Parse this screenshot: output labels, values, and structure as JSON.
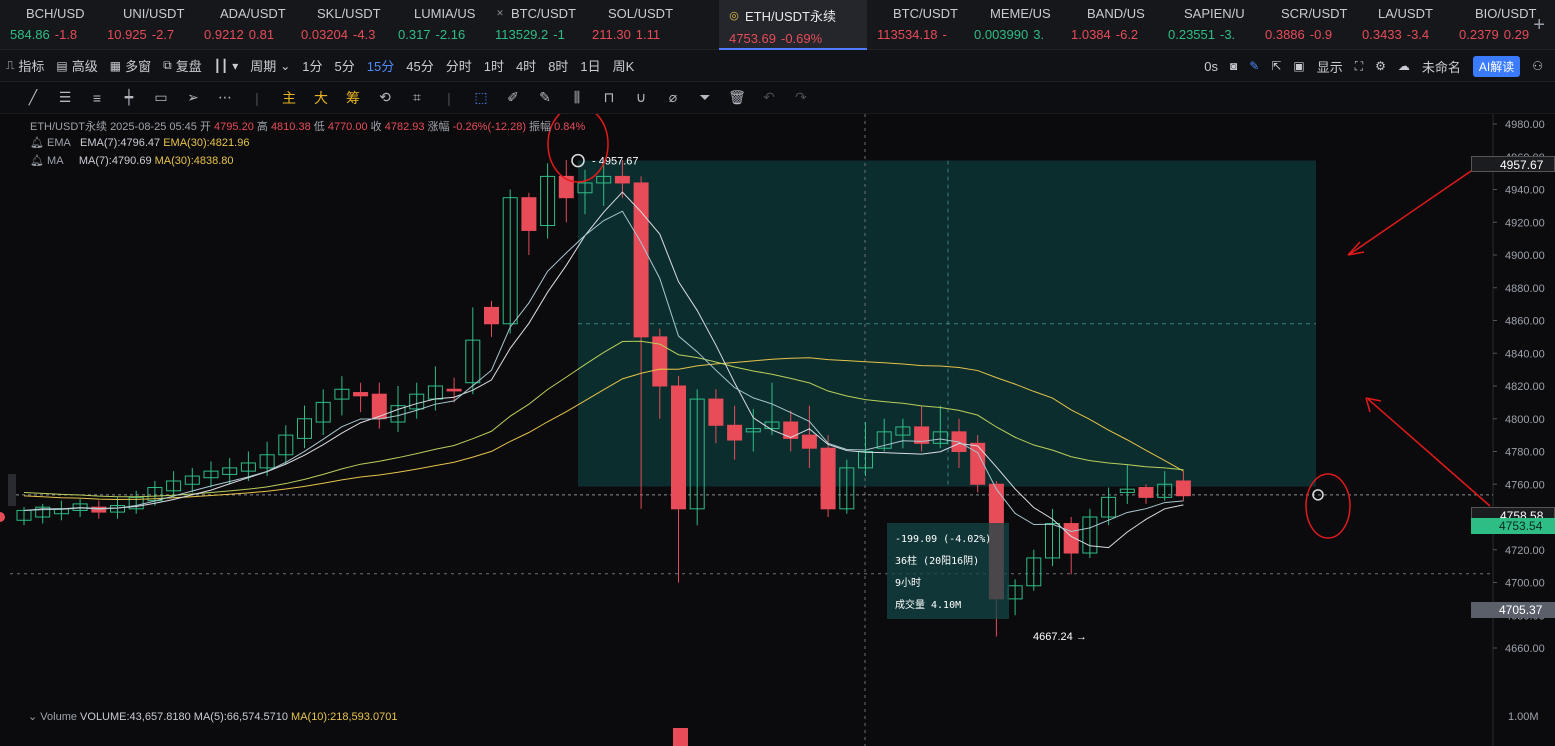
{
  "tickers": [
    {
      "name": "BCH/USD",
      "icon": "",
      "price": "584.86",
      "change": "-1.8",
      "price_dir": "up",
      "change_dir": "dn"
    },
    {
      "name": "UNI/USDT",
      "icon": "",
      "price": "10.925",
      "change": "-2.7",
      "price_dir": "dn",
      "change_dir": "dn"
    },
    {
      "name": "ADA/USDT",
      "icon": "",
      "price": "0.9212",
      "change": "0.81",
      "price_dir": "dn",
      "change_dir": "dn"
    },
    {
      "name": "SKL/USDT",
      "icon": "",
      "price": "0.03204",
      "change": "-4.3",
      "price_dir": "dn",
      "change_dir": "dn"
    },
    {
      "name": "LUMIA/US",
      "icon": "",
      "price": "0.317",
      "change": "-2.16",
      "price_dir": "up",
      "change_dir": "up"
    },
    {
      "name": "BTC/USDT",
      "icon": "✕",
      "price": "113529.2",
      "change": "-1",
      "price_dir": "up",
      "change_dir": "up"
    },
    {
      "name": "SOL/USDT",
      "icon": "",
      "price": "211.30",
      "change": "1.11",
      "price_dir": "dn",
      "change_dir": "dn"
    },
    {
      "name": "ETH/USDT永续",
      "icon": "◎",
      "price": "4753.69",
      "change": "-0.69%",
      "price_dir": "dn",
      "change_dir": "dn",
      "active": true
    },
    {
      "name": "BTC/USDT",
      "icon": "",
      "price": "113534.18",
      "change": "-",
      "price_dir": "dn",
      "change_dir": "dn"
    },
    {
      "name": "MEME/US",
      "icon": "",
      "price": "0.003990",
      "change": "3.",
      "price_dir": "up",
      "change_dir": "up"
    },
    {
      "name": "BAND/US",
      "icon": "",
      "price": "1.0384",
      "change": "-6.2",
      "price_dir": "dn",
      "change_dir": "dn"
    },
    {
      "name": "SAPIEN/U",
      "icon": "",
      "price": "0.23551",
      "change": "-3.",
      "price_dir": "up",
      "change_dir": "up"
    },
    {
      "name": "SCR/USDT",
      "icon": "",
      "price": "0.3886",
      "change": "-0.9",
      "price_dir": "dn",
      "change_dir": "dn"
    },
    {
      "name": "LA/USDT",
      "icon": "",
      "price": "0.3433",
      "change": "-3.4",
      "price_dir": "dn",
      "change_dir": "dn"
    },
    {
      "name": "BIO/USDT",
      "icon": "",
      "price": "0.2379",
      "change": "0.29",
      "price_dir": "dn",
      "change_dir": "dn"
    }
  ],
  "toolbar": {
    "indicators": "指标",
    "advanced": "高级",
    "multi_window": "多窗",
    "replay": "复盘",
    "period": "周期",
    "intervals": [
      "1分",
      "5分",
      "15分",
      "45分",
      "分时",
      "1时",
      "4时",
      "8时",
      "1日",
      "周K"
    ],
    "active_interval": "15分",
    "countdown": "0s",
    "display": "显示",
    "layout_name": "未命名",
    "ai_button": "AI解读"
  },
  "drawbar": {
    "main_label": "主",
    "big_label": "大",
    "chip_label": "筹"
  },
  "chart_info": {
    "symbol": "ETH/USDT永续",
    "datetime": "2025-08-25 05:45",
    "open_label": "开",
    "open": "4795.20",
    "high_label": "高",
    "high": "4810.38",
    "low_label": "低",
    "low": "4770.00",
    "close_label": "收",
    "close": "4782.93",
    "change_label": "涨幅",
    "change": "-0.26%(-12.28)",
    "amp_label": "振幅",
    "amp": "0.84%",
    "ema_label": "EMA",
    "ema7": "EMA(7):4796.47",
    "ema30": "EMA(30):4821.96",
    "ma_label": "MA",
    "ma7": "MA(7):4790.69",
    "ma30": "MA(30):4838.80",
    "volume_label": "Volume",
    "volume": "VOLUME:43,657.8180",
    "vol_ma5": "MA(5):66,574.5710",
    "vol_ma10": "MA(10):218,593.0701"
  },
  "measure": {
    "change": "-199.09 (-4.02%)",
    "bars": "36柱 (20阳16阴)",
    "duration": "9小时",
    "volume": "成交量 4.10M"
  },
  "annotations": {
    "high_marker": "4957.67",
    "low_marker": "4667.24"
  },
  "price_tags": {
    "top": "4957.67",
    "mid": "4758.58",
    "current": "4753.54",
    "cursor": "4705.37"
  },
  "colors": {
    "up": "#2ebd85",
    "down": "#e74c58",
    "accent": "#4f8bff",
    "ma_yellow": "#e6c34a",
    "ema_green": "#b8cf5a",
    "white_line": "#d9dde3",
    "measure_fill": "#0f4a48"
  },
  "chart_data": {
    "type": "candlestick",
    "y_axis_ticks": [
      4980,
      4960,
      4940,
      4920,
      4900,
      4880,
      4860,
      4840,
      4820,
      4800,
      4780,
      4760,
      4740,
      4720,
      4700,
      4680,
      4660
    ],
    "y_axis_labels": [
      "4980.00",
      "4960.00",
      "4940.00",
      "4920.00",
      "4900.00",
      "4880.00",
      "4860.00",
      "4840.00",
      "4820.00",
      "4800.00",
      "4780.00",
      "4760.00",
      "4740.00",
      "4720.00",
      "4700.00",
      "4680.00",
      "4660.00"
    ],
    "volume_axis_label": "1.00M",
    "ylim": [
      4650,
      4985
    ],
    "candles": [
      [
        4738,
        4744,
        4735,
        4746
      ],
      [
        4740,
        4746,
        4736,
        4748
      ],
      [
        4742,
        4745,
        4738,
        4750
      ],
      [
        4744,
        4748,
        4740,
        4751
      ],
      [
        4746,
        4743,
        4739,
        4750
      ],
      [
        4743,
        4747,
        4739,
        4752
      ],
      [
        4745,
        4752,
        4742,
        4756
      ],
      [
        4750,
        4758,
        4747,
        4762
      ],
      [
        4756,
        4762,
        4752,
        4768
      ],
      [
        4760,
        4765,
        4755,
        4770
      ],
      [
        4764,
        4768,
        4758,
        4774
      ],
      [
        4766,
        4770,
        4760,
        4776
      ],
      [
        4768,
        4773,
        4762,
        4780
      ],
      [
        4770,
        4778,
        4765,
        4786
      ],
      [
        4778,
        4790,
        4772,
        4796
      ],
      [
        4788,
        4800,
        4782,
        4808
      ],
      [
        4798,
        4810,
        4790,
        4818
      ],
      [
        4812,
        4818,
        4802,
        4826
      ],
      [
        4816,
        4814,
        4804,
        4822
      ],
      [
        4815,
        4800,
        4794,
        4822
      ],
      [
        4798,
        4808,
        4792,
        4820
      ],
      [
        4806,
        4815,
        4800,
        4822
      ],
      [
        4812,
        4820,
        4805,
        4832
      ],
      [
        4818,
        4817,
        4810,
        4825
      ],
      [
        4822,
        4848,
        4815,
        4868
      ],
      [
        4868,
        4858,
        4850,
        4872
      ],
      [
        4858,
        4935,
        4852,
        4940
      ],
      [
        4935,
        4915,
        4900,
        4938
      ],
      [
        4918,
        4948,
        4910,
        4956
      ],
      [
        4948,
        4935,
        4920,
        4958
      ],
      [
        4938,
        4944,
        4925,
        4952
      ],
      [
        4944,
        4948,
        4930,
        4956
      ],
      [
        4948,
        4944,
        4935,
        4958
      ],
      [
        4944,
        4850,
        4745,
        4948
      ],
      [
        4850,
        4820,
        4800,
        4855
      ],
      [
        4820,
        4745,
        4700,
        4826
      ],
      [
        4745,
        4812,
        4735,
        4818
      ],
      [
        4812,
        4796,
        4785,
        4818
      ],
      [
        4796,
        4787,
        4775,
        4808
      ],
      [
        4792,
        4794,
        4780,
        4806
      ],
      [
        4794,
        4798,
        4790,
        4822
      ],
      [
        4798,
        4788,
        4780,
        4805
      ],
      [
        4790,
        4782,
        4770,
        4808
      ],
      [
        4782,
        4745,
        4740,
        4790
      ],
      [
        4745,
        4770,
        4742,
        4775
      ],
      [
        4770,
        4780,
        4765,
        4798
      ],
      [
        4782,
        4792,
        4780,
        4800
      ],
      [
        4790,
        4795,
        4782,
        4800
      ],
      [
        4795,
        4785,
        4780,
        4808
      ],
      [
        4785,
        4792,
        4782,
        4808
      ],
      [
        4792,
        4780,
        4770,
        4800
      ],
      [
        4785,
        4760,
        4755,
        4790
      ],
      [
        4760,
        4690,
        4667,
        4762
      ],
      [
        4690,
        4698,
        4680,
        4702
      ],
      [
        4698,
        4715,
        4695,
        4720
      ],
      [
        4715,
        4736,
        4710,
        4745
      ],
      [
        4736,
        4718,
        4705,
        4740
      ],
      [
        4718,
        4740,
        4715,
        4745
      ],
      [
        4740,
        4752,
        4735,
        4758
      ],
      [
        4755,
        4757,
        4748,
        4772
      ],
      [
        4758,
        4752,
        4748,
        4760
      ],
      [
        4752,
        4760,
        4750,
        4768
      ],
      [
        4762,
        4753,
        4750,
        4768
      ]
    ]
  }
}
